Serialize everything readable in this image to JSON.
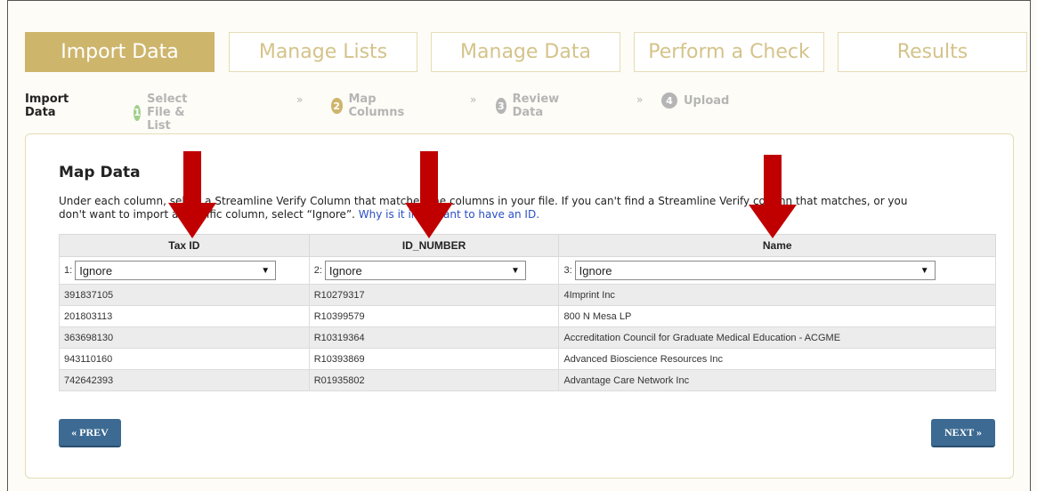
{
  "tabs": [
    {
      "label": "Import Data",
      "active": true
    },
    {
      "label": "Manage Lists",
      "active": false
    },
    {
      "label": "Manage Data",
      "active": false
    },
    {
      "label": "Perform a Check",
      "active": false
    },
    {
      "label": "Results",
      "active": false
    }
  ],
  "steps": {
    "title": "Import Data",
    "items": [
      {
        "num": "1",
        "label": "Select File & List",
        "color": "#9fd08a"
      },
      {
        "num": "2",
        "label": "Map Columns",
        "color": "#cdb56c"
      },
      {
        "num": "3",
        "label": "Review Data",
        "color": "#b5b5b5"
      },
      {
        "num": "4",
        "label": "Upload",
        "color": "#b5b5b5"
      }
    ],
    "separator": "»"
  },
  "panel": {
    "title": "Map Data",
    "desc_line1": "Under each column, select a Streamline Verify Column that matches the columns in your file. If you can't find a Streamline Verify column that matches, or you",
    "desc_line2_pre": "don't want to import a specific column, select “Ignore”. ",
    "desc_link": "Why is it important to have an ID."
  },
  "table": {
    "headers": [
      "Tax ID",
      "ID_NUMBER",
      "Name"
    ],
    "selects": [
      {
        "prefix": "1:",
        "value": "Ignore"
      },
      {
        "prefix": "2:",
        "value": "Ignore"
      },
      {
        "prefix": "3:",
        "value": "Ignore"
      }
    ],
    "rows": [
      [
        "391837105",
        "R10279317",
        "4Imprint Inc"
      ],
      [
        "201803113",
        "R10399579",
        "800 N Mesa LP"
      ],
      [
        "363698130",
        "R10319364",
        "Accreditation Council for Graduate Medical Education - ACGME"
      ],
      [
        "943110160",
        "R10393869",
        "Advanced Bioscience Resources Inc"
      ],
      [
        "742642393",
        "R01935802",
        "Advantage Care Network Inc"
      ]
    ]
  },
  "buttons": {
    "prev": "« PREV",
    "next": "NEXT »"
  },
  "colors": {
    "accent": "#cdb56c",
    "button": "#3c6a92",
    "arrow": "#c00000"
  }
}
